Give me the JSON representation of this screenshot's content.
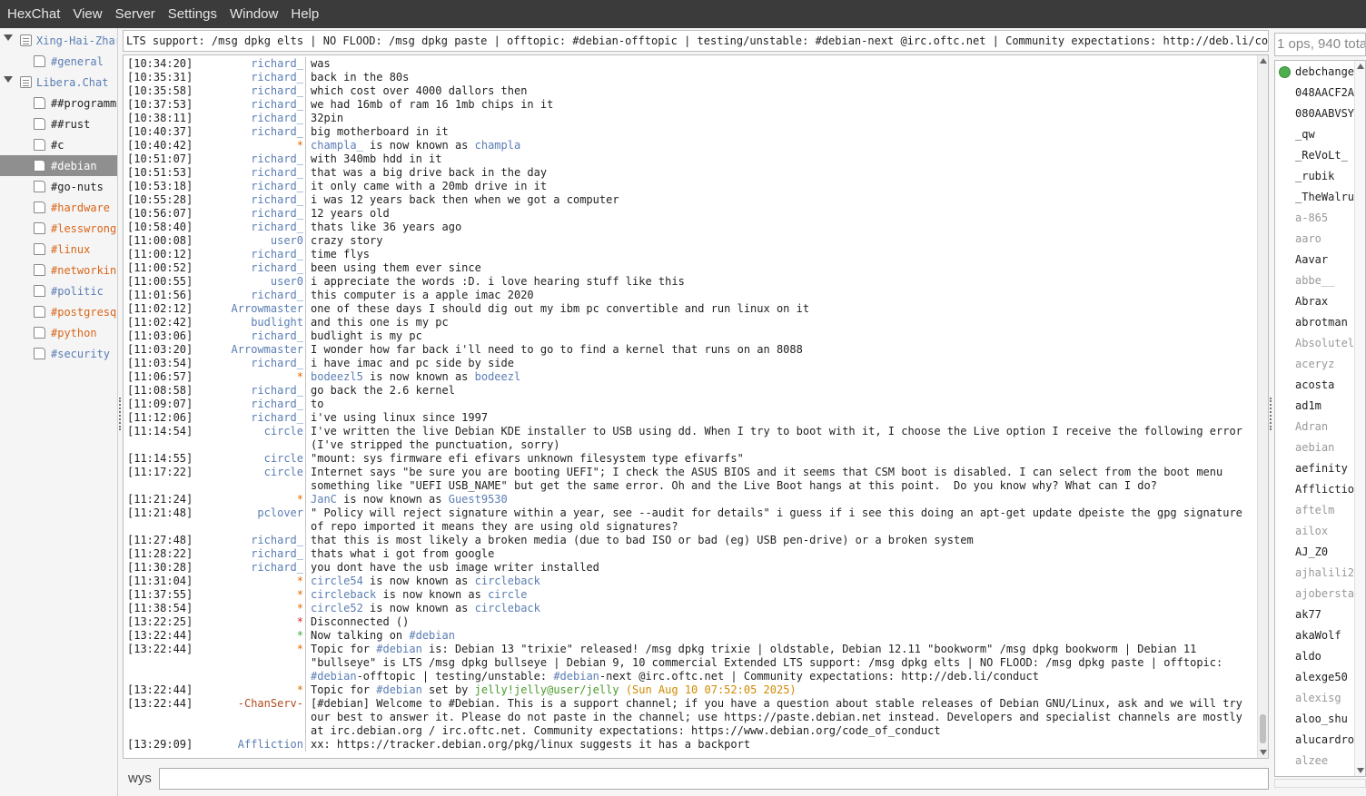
{
  "menubar": [
    "HexChat",
    "View",
    "Server",
    "Settings",
    "Window",
    "Help"
  ],
  "tree": {
    "servers": [
      {
        "label": "Xing-Hai-Zhar",
        "channels": [
          {
            "label": "#general",
            "color": "#5a7db4"
          }
        ]
      },
      {
        "label": "Libera.Chat",
        "channels": [
          {
            "label": "##programm",
            "color": "#222222"
          },
          {
            "label": "##rust",
            "color": "#222222"
          },
          {
            "label": "#c",
            "color": "#222222"
          },
          {
            "label": "#debian",
            "color": "#ffffff",
            "selected": true
          },
          {
            "label": "#go-nuts",
            "color": "#222222"
          },
          {
            "label": "#hardware",
            "color": "#d9661a"
          },
          {
            "label": "#lesswrong",
            "color": "#d9661a"
          },
          {
            "label": "#linux",
            "color": "#d9661a"
          },
          {
            "label": "#networkin",
            "color": "#d9661a"
          },
          {
            "label": "#politic",
            "color": "#5a7db4"
          },
          {
            "label": "#postgresq",
            "color": "#d9661a"
          },
          {
            "label": "#python",
            "color": "#d9661a"
          },
          {
            "label": "#security",
            "color": "#5a7db4"
          }
        ]
      }
    ]
  },
  "topic": "LTS support: /msg dpkg elts | NO FLOOD: /msg dpkg paste | offtopic: #debian-offtopic | testing/unstable: #debian-next @irc.oftc.net | Community expectations: http://deb.li/conduct",
  "chat": [
    [
      "[10:34:20]",
      "richard_",
      "was",
      "a"
    ],
    [
      "[10:35:31]",
      "richard_",
      "back in the 80s",
      "a"
    ],
    [
      "[10:35:58]",
      "richard_",
      "which cost over 4000 dallors then",
      "a"
    ],
    [
      "[10:37:53]",
      "richard_",
      "we had 16mb of ram 16 1mb chips in it",
      "a"
    ],
    [
      "[10:38:11]",
      "richard_",
      "32pin",
      "a"
    ],
    [
      "[10:40:37]",
      "richard_",
      "big motherboard in it",
      "a"
    ],
    [
      "[10:40:42]",
      "*",
      "champla_ is now known as champla",
      "event"
    ],
    [
      "[10:51:07]",
      "richard_",
      "with 340mb hdd in it",
      "a"
    ],
    [
      "[10:51:53]",
      "richard_",
      "that was a big drive back in the day",
      "a"
    ],
    [
      "[10:53:18]",
      "richard_",
      "it only came with a 20mb drive in it",
      "a"
    ],
    [
      "[10:55:28]",
      "richard_",
      "i was 12 years back then when we got a computer",
      "a"
    ],
    [
      "[10:56:07]",
      "richard_",
      "12 years old",
      "a"
    ],
    [
      "[10:58:40]",
      "richard_",
      "thats like 36 years ago",
      "a"
    ],
    [
      "[11:00:08]",
      "user0",
      "crazy story",
      "a"
    ],
    [
      "[11:00:12]",
      "richard_",
      "time flys",
      "a"
    ],
    [
      "[11:00:52]",
      "richard_",
      "been using them ever since",
      "a"
    ],
    [
      "[11:00:55]",
      "user0",
      "i appreciate the words :D. i love hearing stuff like this",
      "a"
    ],
    [
      "[11:01:56]",
      "richard_",
      "this computer is a apple imac 2020",
      "a"
    ],
    [
      "[11:02:12]",
      "Arrowmaster",
      "one of these days I should dig out my ibm pc convertible and run linux on it",
      "a"
    ],
    [
      "[11:02:42]",
      "budlight",
      "and this one is my pc",
      "a"
    ],
    [
      "[11:03:06]",
      "richard_",
      "budlight is my pc",
      "a"
    ],
    [
      "[11:03:20]",
      "Arrowmaster",
      "I wonder how far back i'll need to go to find a kernel that runs on an 8088",
      "a"
    ],
    [
      "[11:03:54]",
      "richard_",
      "i have imac and pc side by side",
      "a"
    ],
    [
      "[11:06:57]",
      "*",
      "bodeezl5 is now known as bodeezl",
      "event"
    ],
    [
      "[11:08:58]",
      "richard_",
      "go back the 2.6 kernel",
      "a"
    ],
    [
      "[11:09:07]",
      "richard_",
      "to",
      "a"
    ],
    [
      "[11:12:06]",
      "richard_",
      "i've using linux since 1997",
      "a"
    ],
    [
      "[11:14:54]",
      "circle",
      "I've written the live Debian KDE installer to USB using dd. When I try to boot with it, I choose the Live option I receive the following error (I've stripped the punctuation, sorry)",
      "a"
    ],
    [
      "[11:14:55]",
      "circle",
      "\"mount: sys firmware efi efivars unknown filesystem type efivarfs\"",
      "a"
    ],
    [
      "[11:17:22]",
      "circle",
      "Internet says \"be sure you are booting UEFI\"; I check the ASUS BIOS and it seems that CSM boot is disabled. I can select from the boot menu something like \"UEFI USB_NAME\" but get the same error. Oh and the Live Boot hangs at this point.  Do you know why? What can I do?",
      "a"
    ],
    [
      "[11:21:24]",
      "*",
      "JanC is now known as Guest9530",
      "event"
    ],
    [
      "[11:21:48]",
      "pclover",
      "\" Policy will reject signature within a year, see --audit for details\" i guess if i see this doing an apt-get update dpeiste the gpg signature of repo imported it means they are using old signatures?",
      "a"
    ],
    [
      "[11:27:48]",
      "richard_",
      "that this is most likely a broken media (due to bad ISO or bad (eg) USB pen-drive) or a broken system",
      "a"
    ],
    [
      "[11:28:22]",
      "richard_",
      "thats what i got from google",
      "a"
    ],
    [
      "[11:30:28]",
      "richard_",
      "you dont have the usb image writer installed",
      "a"
    ],
    [
      "[11:31:04]",
      "*",
      "circle54 is now known as circleback",
      "event"
    ],
    [
      "[11:37:55]",
      "*",
      "circleback is now known as circle",
      "event"
    ],
    [
      "[11:38:54]",
      "*",
      "circle52 is now known as circleback",
      "event"
    ],
    [
      "[13:22:25]",
      "*",
      "Disconnected ()",
      "err"
    ],
    [
      "[13:22:44]",
      "*",
      "Now talking on #debian",
      "ok"
    ],
    [
      "[13:22:44]",
      "*",
      "Topic for #debian is: Debian 13 \"trixie\" released! /msg dpkg trixie | oldstable, Debian 12.11 \"bookworm\" /msg dpkg bookworm | Debian 11 \"bullseye\" is LTS /msg dpkg bullseye | Debian 9, 10 commercial Extended LTS support: /msg dpkg elts | NO FLOOD: /msg dpkg paste | offtopic: #debian-offtopic | testing/unstable: #debian-next @irc.oftc.net | Community expectations: http://deb.li/conduct",
      "topic"
    ],
    [
      "[13:22:44]",
      "*",
      "Topic for #debian set by jelly!jelly@user/jelly (Sun Aug 10 07:52:05 2025)",
      "topic"
    ],
    [
      "[13:22:44]",
      "-ChanServ-",
      "[#debian] Welcome to #Debian. This is a support channel; if you have a question about stable releases of Debian GNU/Linux, ask and we will try our best to answer it. Please do not paste in the channel; use https://paste.debian.net instead. Developers and specialist channels are mostly at irc.debian.org / irc.oftc.net. Community expectations: https://www.debian.org/code_of_conduct",
      "notice"
    ],
    [
      "[13:29:09]",
      "Affliction",
      "xx: https://tracker.debian.org/pkg/linux suggests it has a backport",
      "a"
    ]
  ],
  "input": {
    "nick": "wys"
  },
  "userlist": {
    "header": "1 ops, 940 tota",
    "users": [
      {
        "name": "debchange",
        "op": true,
        "away": false
      },
      {
        "name": "048AACF2A",
        "away": false
      },
      {
        "name": "080AABVSY",
        "away": false
      },
      {
        "name": "_qw",
        "away": false
      },
      {
        "name": "_ReVoLt_",
        "away": false
      },
      {
        "name": "_rubik",
        "away": false
      },
      {
        "name": "_TheWalru",
        "away": false
      },
      {
        "name": "a-865",
        "away": true
      },
      {
        "name": "aaro",
        "away": true
      },
      {
        "name": "Aavar",
        "away": false
      },
      {
        "name": "abbe__",
        "away": true
      },
      {
        "name": "Abrax",
        "away": false
      },
      {
        "name": "abrotman",
        "away": false
      },
      {
        "name": "Absolutel",
        "away": true
      },
      {
        "name": "aceryz",
        "away": true
      },
      {
        "name": "acosta",
        "away": false
      },
      {
        "name": "ad1m",
        "away": false
      },
      {
        "name": "Adran",
        "away": true
      },
      {
        "name": "aebian",
        "away": true
      },
      {
        "name": "aefinity",
        "away": false
      },
      {
        "name": "Afflictio",
        "away": false
      },
      {
        "name": "aftelm",
        "away": true
      },
      {
        "name": "ailox",
        "away": true
      },
      {
        "name": "AJ_Z0",
        "away": false
      },
      {
        "name": "ajhalili2",
        "away": true
      },
      {
        "name": "ajobersta",
        "away": true
      },
      {
        "name": "ak77",
        "away": false
      },
      {
        "name": "akaWolf",
        "away": false
      },
      {
        "name": "aldo",
        "away": false
      },
      {
        "name": "alexge50",
        "away": false
      },
      {
        "name": "alexisg",
        "away": true
      },
      {
        "name": "aloo_shu",
        "away": false
      },
      {
        "name": "alucardro",
        "away": false
      },
      {
        "name": "alzee",
        "away": true
      }
    ]
  }
}
